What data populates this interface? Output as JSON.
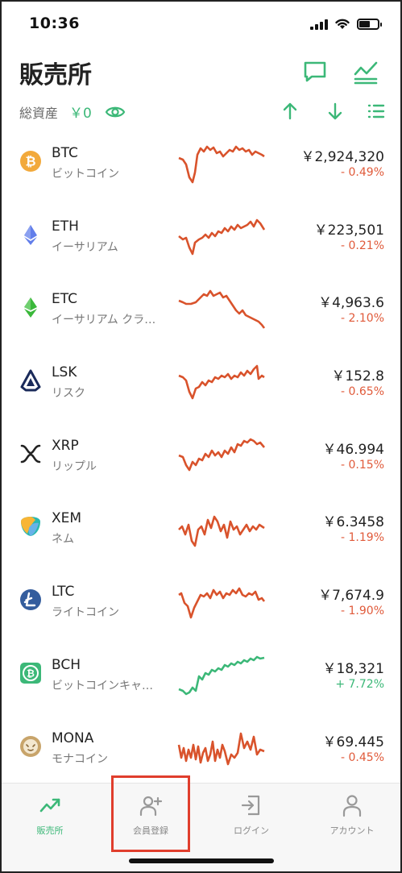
{
  "status_bar": {
    "time": "10:36"
  },
  "header": {
    "title": "販売所",
    "assets_label": "総資産",
    "assets_value": "￥0"
  },
  "coins": [
    {
      "symbol": "BTC",
      "name": "ビットコイン",
      "price": "￥2,924,320",
      "change": "- 0.49%",
      "trend": "down",
      "color": "#f2a93b"
    },
    {
      "symbol": "ETH",
      "name": "イーサリアム",
      "price": "￥223,501",
      "change": "- 0.21%",
      "trend": "down",
      "color": "#627eea"
    },
    {
      "symbol": "ETC",
      "name": "イーサリアム クラ…",
      "price": "￥4,963.6",
      "change": "- 2.10%",
      "trend": "down",
      "color": "#3ab83a"
    },
    {
      "symbol": "LSK",
      "name": "リスク",
      "price": "￥152.8",
      "change": "- 0.65%",
      "trend": "down",
      "color": "#1a2a5a"
    },
    {
      "symbol": "XRP",
      "name": "リップル",
      "price": "￥46.994",
      "change": "- 0.15%",
      "trend": "down",
      "color": "#222222"
    },
    {
      "symbol": "XEM",
      "name": "ネム",
      "price": "￥6.3458",
      "change": "- 1.19%",
      "trend": "down",
      "color": "#2ab8b0"
    },
    {
      "symbol": "LTC",
      "name": "ライトコイン",
      "price": "￥7,674.9",
      "change": "- 1.90%",
      "trend": "down",
      "color": "#345d9d"
    },
    {
      "symbol": "BCH",
      "name": "ビットコインキャ…",
      "price": "￥18,321",
      "change": "+ 7.72%",
      "trend": "up",
      "color": "#3cb878"
    },
    {
      "symbol": "MONA",
      "name": "モナコイン",
      "price": "￥69.445",
      "change": "- 0.45%",
      "trend": "down",
      "color": "#c8a46a"
    }
  ],
  "tabs": [
    {
      "label": "販売所",
      "icon": "chart-up-icon",
      "active": true
    },
    {
      "label": "会員登録",
      "icon": "add-user-icon",
      "active": false
    },
    {
      "label": "ログイン",
      "icon": "login-icon",
      "active": false
    },
    {
      "label": "アカウント",
      "icon": "account-icon",
      "active": false
    }
  ],
  "colors": {
    "accent": "#3cb878",
    "negative": "#e05a3a",
    "highlight": "#e03e2d"
  }
}
